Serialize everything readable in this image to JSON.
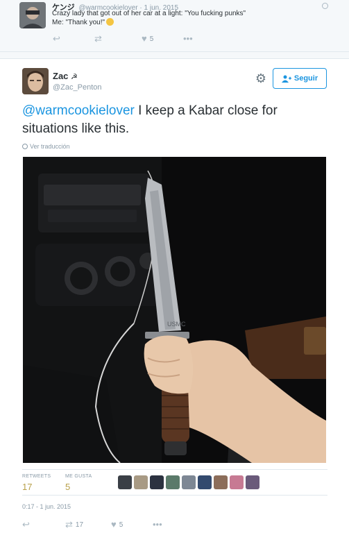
{
  "parent_tweet": {
    "name": "ケンジ",
    "handle": "@warmcookielover",
    "date": "· 1 jun. 2015",
    "text_line1": "Crazy lady that got out of her car at a light: \"You fucking punks\"",
    "text_line2": "Me: \"Thank you!\"",
    "likes": "5"
  },
  "main_tweet": {
    "name": "Zac",
    "handle": "@Zac_Penton",
    "follow_label": "Seguir",
    "mention": "@warmcookielover",
    "text": " I keep a Kabar close for situations like this.",
    "translate_label": "Ver traducción",
    "photo_engraving": "USMC",
    "retweets_label": "RETWEETS",
    "retweets_value": "17",
    "likes_label": "ME GUSTA",
    "likes_value": "5",
    "timestamp": "0:17 - 1 jun. 2015",
    "action_retweets": "17",
    "action_likes": "5"
  },
  "icons": {
    "reply": "reply-icon",
    "retweet": "retweet-icon",
    "like": "heart-icon",
    "more": "more-icon",
    "gear": "gear-icon",
    "follow": "add-user-icon",
    "globe": "globe-icon"
  },
  "colors": {
    "accent": "#1b95e0",
    "count": "#b8a04a",
    "muted": "#8899a6"
  }
}
